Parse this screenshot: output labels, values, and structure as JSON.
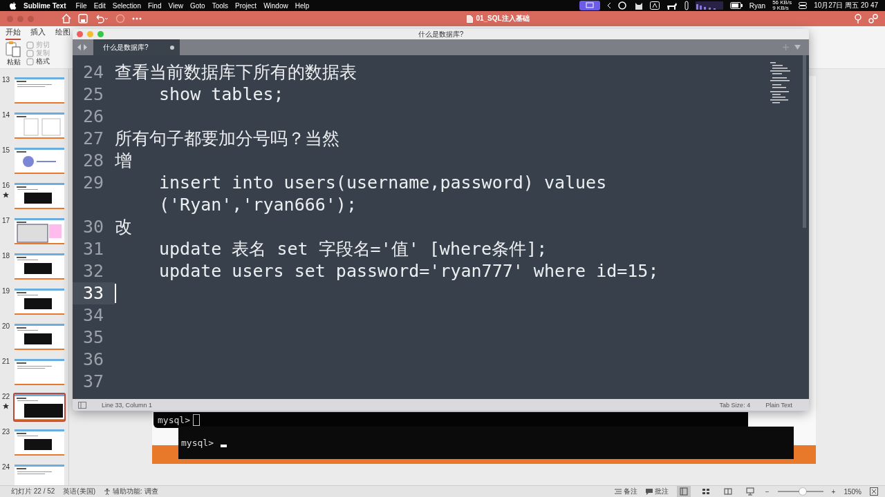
{
  "menu_bar": {
    "app": "Sublime Text",
    "items": [
      "File",
      "Edit",
      "Selection",
      "Find",
      "View",
      "Goto",
      "Tools",
      "Project",
      "Window",
      "Help"
    ],
    "user": "Ryan",
    "net_up": "56 KB/s",
    "net_down": "9 KB/s",
    "clock": "10月27日 周五 20 47"
  },
  "presentation": {
    "title": "01_SQL注入基础",
    "ribbon_tabs": [
      {
        "label": "开始",
        "selected": true
      },
      {
        "label": "插入",
        "selected": false
      },
      {
        "label": "绘图",
        "selected": false
      }
    ],
    "clipboard": {
      "paste": "粘贴",
      "cut": "剪切",
      "copy": "复制",
      "format": "格式"
    },
    "slides": [
      {
        "number": "13",
        "starred": false,
        "selected": false,
        "kind": "text"
      },
      {
        "number": "14",
        "starred": false,
        "selected": false,
        "kind": "diagram"
      },
      {
        "number": "15",
        "starred": false,
        "selected": false,
        "kind": "title"
      },
      {
        "number": "16",
        "starred": true,
        "selected": false,
        "kind": "terminal"
      },
      {
        "number": "17",
        "starred": false,
        "selected": false,
        "kind": "screenshot"
      },
      {
        "number": "18",
        "starred": false,
        "selected": false,
        "kind": "terminal"
      },
      {
        "number": "19",
        "starred": false,
        "selected": false,
        "kind": "terminal"
      },
      {
        "number": "20",
        "starred": false,
        "selected": false,
        "kind": "terminal"
      },
      {
        "number": "21",
        "starred": false,
        "selected": false,
        "kind": "text"
      },
      {
        "number": "22",
        "starred": true,
        "selected": true,
        "kind": "terminal"
      },
      {
        "number": "23",
        "starred": false,
        "selected": false,
        "kind": "terminal"
      },
      {
        "number": "24",
        "starred": false,
        "selected": false,
        "kind": "text"
      }
    ],
    "slide_terminal": {
      "prompt_1": "mysql>",
      "prompt_2": "mysql>"
    },
    "status_bar": {
      "slide_count": "幻灯片 22 / 52",
      "language": "英语(美国)",
      "accessibility": "辅助功能: 调查",
      "notes": "备注",
      "comments": "批注",
      "views": [
        {
          "kind": "normal",
          "selected": true
        },
        {
          "kind": "sorter",
          "selected": false
        },
        {
          "kind": "reading",
          "selected": false
        },
        {
          "kind": "slideshow",
          "selected": false
        }
      ],
      "zoom_out": "−",
      "level": 0.55,
      "zoom_in": "+",
      "zoom": "150%"
    }
  },
  "editor": {
    "window_title": "什么是数据库?",
    "tabs": [
      {
        "label": "什么是数据库?",
        "selected": true,
        "modified": true
      }
    ],
    "lines": [
      {
        "number": "24",
        "text": "查看当前数据库下所有的数据表",
        "indented": false,
        "current": false
      },
      {
        "number": "25",
        "text": "show tables;",
        "indented": true,
        "current": false
      },
      {
        "number": "26",
        "current": false
      },
      {
        "number": "27",
        "text": "所有句子都要加分号吗？当然",
        "indented": false,
        "current": false
      },
      {
        "number": "28",
        "text": "增",
        "indented": false,
        "current": false
      },
      {
        "number": "29",
        "text": "insert into users(username,password) values",
        "wrap": "('Ryan','ryan666');",
        "indented": true,
        "current": false
      },
      {
        "number": "30",
        "text": "改",
        "indented": false,
        "current": false
      },
      {
        "number": "31",
        "text": "update 表名 set 字段名='值' [where条件];",
        "indented": true,
        "current": false
      },
      {
        "number": "32",
        "text": "update users set password='ryan777' where id=15;",
        "indented": true,
        "current": false
      },
      {
        "number": "33",
        "current": true
      },
      {
        "number": "34",
        "current": false
      },
      {
        "number": "35",
        "current": false
      },
      {
        "number": "36",
        "current": false
      },
      {
        "number": "37",
        "current": false
      }
    ],
    "status": {
      "position": "Line 33, Column 1",
      "tab_size": "Tab Size: 4",
      "syntax": "Plain Text"
    }
  }
}
